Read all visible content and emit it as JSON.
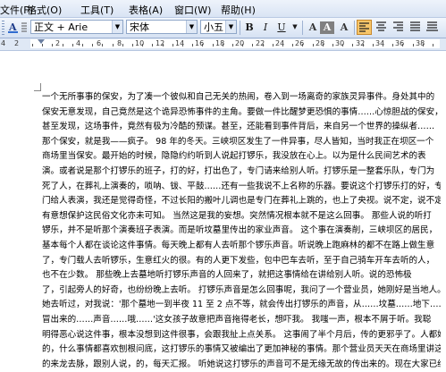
{
  "menu": [
    {
      "label": "文件(F)",
      "name": "menu-file"
    },
    {
      "label": "格式(O)",
      "name": "menu-format"
    },
    {
      "label": "工具(T)",
      "name": "menu-tools"
    },
    {
      "label": "表格(A)",
      "name": "menu-table"
    },
    {
      "label": "窗口(W)",
      "name": "menu-window"
    },
    {
      "label": "帮助(H)",
      "name": "menu-help"
    }
  ],
  "toolbar": {
    "style_value": "正文 + Arie",
    "font_value": "宋体",
    "size_value": "小五",
    "bold": "B",
    "italic": "I",
    "underline": "U",
    "font_color": "A",
    "char_shading": "A",
    "char_scale": "A"
  },
  "ruler": {
    "numbers": [
      "4",
      "2",
      "2",
      "4",
      "6",
      "8",
      "10",
      "12",
      "14",
      "16",
      "18",
      "20",
      "22",
      "24",
      "26",
      "28",
      "30",
      "32",
      "34",
      "36",
      "38"
    ]
  },
  "document": {
    "lines": [
      "一个无所事事的保安，为了凑一个彼似和自己无关的热闹，卷入到一场离奇的家族灵异事件。身处其中的",
      "保安无意发现，自己竟然是这个诡异恐怖事件的主角。要做一件比醒梦更恐惧的事情……心惊胆战的保安，",
      "甚至发现，这场事件，竟然有极为冷酷的预谋。甚至，还能看到事件背后，来自另一个世界的操纵者……",
      "那个保安，就是我——疯子。  98 年的冬天。三峡坝区发生了一件异事，尽人皆知，当时我正在坝区一个",
      "商场里当保安。最开始的时候，隐隐约约听到人说起打锣乐，我没放在心上。以为是什么民间艺术的表",
      "演。或者说是那个打锣乐的班子，打的好，打出色了，专门请来给别人听。打锣乐是一整套乐队，专门为",
      "死了人，在葬礼上演奏的，唢呐、钹、平鼓……还有一些我说不上名称的乐器。要说这个打锣乐打的好，专",
      "门给人表演，我还是觉得奇怪，不过长阳的搬叶儿调也是专门在葬礼上跳的，也上了央视。说不定，说不定",
      "有意想保护这民俗文化亦未可知。  当然这是我的妄想。突然情况根本就不是这么回事。  那些人说的听打",
      "锣乐，并不是听那个演奏班子表演。而是听坟墓里传出的家业声音。  这个事在演奏削，三峡坝区的居民，",
      "基本每个人都在谈论这件事情。每天晚上都有人去听那个锣乐声音。听说晚上跑麻林的都不在路上做生意",
      "了，专门载人去听锣乐，生意红火的很。有的人更下发些，包中巴车去听，至于自己骑车开车去听的人，",
      "也不在少数。  那些晚上去墓地听打锣乐声音的人回来了，就把这事情给在讲给别人听。说的恐怖极",
      "了，引起旁人的好奇，也纷纷晚上去听。  打锣乐声音是怎么回事呢，我问了一个营业员，她刚好是当地人。",
      "她去听过，对我说：'那个墓地一到半夜 11 至 2 点不等，就会传出打锣乐的声音，从……坟墓……地下……",
      "冒出来的……声音……哦……'这女孩子故意把声音拖得老长，想吓我。  我嗤一声，根本不屑于听。我聪",
      "明得恶心说这件事，根本没想到这件很事，会跟我扯上点关系。  这事闹了半个月后，传的更邪乎了。人都好奇",
      "的，什么事情都喜欢刨根问底，这打锣乐的事情又被编出了更加神秘的事情。那个营业员天天在商场里讲这件事情",
      "的来龙去脉，跟别人说，的，每天汇报。  听她说这打锣乐的声音可不是无缘无故的传出来的。现在大家已经",
      "她的家里人说，为了……"
    ]
  }
}
